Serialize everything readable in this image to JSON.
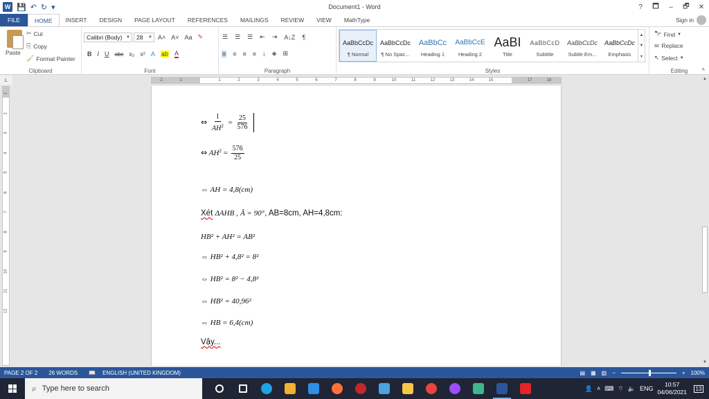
{
  "window": {
    "title": "Document1 - Word",
    "help": "?",
    "restore_ribbon": "🗖",
    "minimize": "–",
    "maximize": "🗗",
    "close": "✕"
  },
  "quick_access": {
    "logo": "W",
    "save_icon": "💾",
    "undo_icon": "↶",
    "redo_icon": "↻",
    "customize": "▾"
  },
  "tabs": [
    "FILE",
    "HOME",
    "INSERT",
    "DESIGN",
    "PAGE LAYOUT",
    "REFERENCES",
    "MAILINGS",
    "REVIEW",
    "VIEW",
    "MathType"
  ],
  "active_tab": "HOME",
  "sign_in": "Sign in",
  "clipboard": {
    "label": "Clipboard",
    "paste": "Paste",
    "cut": "Cut",
    "copy": "Copy",
    "format_painter": "Format Painter"
  },
  "font": {
    "label": "Font",
    "family": "Calibri (Body)",
    "size": "28",
    "grow": "A˄",
    "shrink": "A˅",
    "case": "Aa",
    "bold": "B",
    "italic": "I",
    "underline": "U",
    "strike": "abc",
    "subscript": "x₂",
    "superscript": "x²"
  },
  "paragraph": {
    "label": "Paragraph",
    "pilcrow": "¶",
    "sort": "A↓Z"
  },
  "styles": {
    "label": "Styles",
    "items": [
      {
        "sample": "AaBbCcDc",
        "name": "¶ Normal"
      },
      {
        "sample": "AaBbCcDc",
        "name": "¶ No Spac..."
      },
      {
        "sample": "AaBbCc",
        "name": "Heading 1"
      },
      {
        "sample": "AaBbCcE",
        "name": "Heading 2"
      },
      {
        "sample": "AaBI",
        "name": "Title"
      },
      {
        "sample": "AaBbCcD",
        "name": "Subtitle"
      },
      {
        "sample": "AaBbCcDc",
        "name": "Subtle Em..."
      },
      {
        "sample": "AaBbCcDc",
        "name": "Emphasis"
      }
    ]
  },
  "editing": {
    "label": "Editing",
    "find": "Find",
    "replace": "Replace",
    "select": "Select"
  },
  "ruler": {
    "corner": "L",
    "ticks": [
      "2",
      "1",
      "1",
      "2",
      "3",
      "4",
      "5",
      "6",
      "7",
      "8",
      "9",
      "10",
      "11",
      "12",
      "13",
      "14",
      "15",
      "17",
      "18"
    ],
    "vticks": [
      "1",
      "2",
      "3",
      "4",
      "5",
      "6",
      "7",
      "8",
      "9",
      "10",
      "11",
      "12"
    ]
  },
  "document": {
    "line1": {
      "prefix": "⇔",
      "num": "1",
      "den": "AH",
      "den_sup": "2",
      "eq": "=",
      "num2": "25",
      "den2": "576"
    },
    "line2": {
      "prefix": "⇔",
      "lhs": "AH",
      "lhs_sup": "2",
      "eq": "=",
      "num": "576",
      "den": "25"
    },
    "line3": {
      "text": "⇔ AH = 4,8(cm)"
    },
    "line4": {
      "word": "Xét",
      "triangle": "ΔAHB ,",
      "angle": "Â = 90°",
      "rest": ", AB=8cm, AH=4,8cm:"
    },
    "line5": "HB² + AH² = AB²",
    "line6": "⇔ HB² + 4,8² = 8²",
    "line7": "⇔ HB² = 8² − 4,8²",
    "line8": "⇔ HB² = 40,96²",
    "line9": "⇔ HB = 6,4(cm)",
    "line10": "Vậy..."
  },
  "status": {
    "page": "PAGE 2 OF 2",
    "words": "26 WORDS",
    "proof_icon": "📖",
    "language": "ENGLISH (UNITED KINGDOM)",
    "zoom": "100%",
    "zoom_minus": "−",
    "zoom_plus": "+"
  },
  "taskbar": {
    "search_placeholder": "Type here to search",
    "language": "ENG",
    "time": "10:57",
    "date": "04/06/2021",
    "notifications": "13",
    "icons": [
      {
        "name": "task-view-icon",
        "color": "#ffffff"
      },
      {
        "name": "widgets-icon",
        "color": "#ffffff"
      },
      {
        "name": "edge-icon",
        "color": "#1fa3e6"
      },
      {
        "name": "store-icon",
        "color": "#f2b132"
      },
      {
        "name": "mail-icon",
        "color": "#2f8fe6"
      },
      {
        "name": "firefox-icon",
        "color": "#ff7139"
      },
      {
        "name": "app-red-icon",
        "color": "#c4262e"
      },
      {
        "name": "app-color-icon",
        "color": "#4aa3df"
      },
      {
        "name": "explorer-icon",
        "color": "#f7c748"
      },
      {
        "name": "chrome-icon",
        "color": "#e8453c"
      },
      {
        "name": "messenger-icon",
        "color": "#9b4dff"
      },
      {
        "name": "app-green-icon",
        "color": "#3fb68e"
      },
      {
        "name": "word-icon",
        "color": "#2b579a"
      },
      {
        "name": "check-icon",
        "color": "#e3242b"
      }
    ]
  }
}
